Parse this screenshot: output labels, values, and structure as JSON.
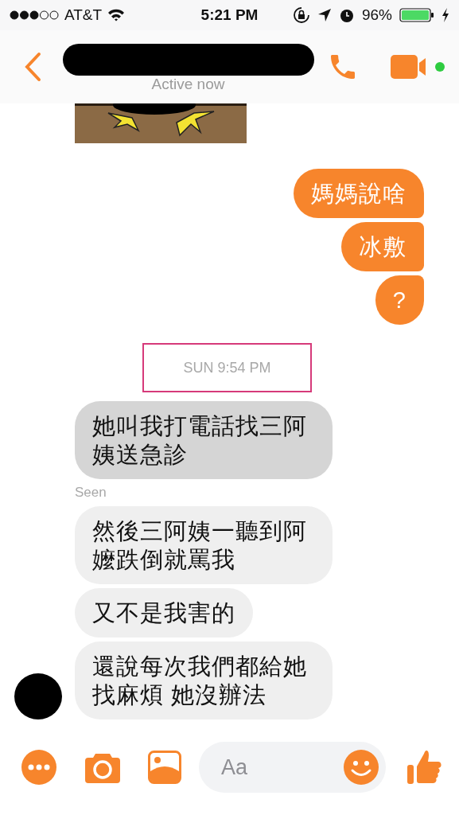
{
  "status_bar": {
    "carrier": "AT&T",
    "time": "5:21 PM",
    "battery": "96%"
  },
  "header": {
    "status": "Active now",
    "online": true
  },
  "messages": [
    {
      "kind": "sticker"
    },
    {
      "kind": "outgoing",
      "text": "媽媽說啥"
    },
    {
      "kind": "outgoing",
      "text": "冰敷"
    },
    {
      "kind": "outgoing",
      "text": "?"
    },
    {
      "kind": "timestamp",
      "text": "SUN 9:54 PM",
      "framed": true
    },
    {
      "kind": "incoming",
      "text": "她叫我打電話找三阿姨送急診",
      "highlighted": true,
      "show_avatar": false
    },
    {
      "kind": "seen",
      "text": "Seen"
    },
    {
      "kind": "incoming",
      "text": "然後三阿姨一聽到阿嬤跌倒就罵我",
      "highlighted": false,
      "show_avatar": false
    },
    {
      "kind": "incoming",
      "text": "又不是我害的",
      "highlighted": false,
      "show_avatar": false
    },
    {
      "kind": "incoming",
      "text": "還說每次我們都給她找麻煩 她沒辦法",
      "highlighted": false,
      "show_avatar": true
    }
  ],
  "composer": {
    "placeholder": "Aa"
  }
}
